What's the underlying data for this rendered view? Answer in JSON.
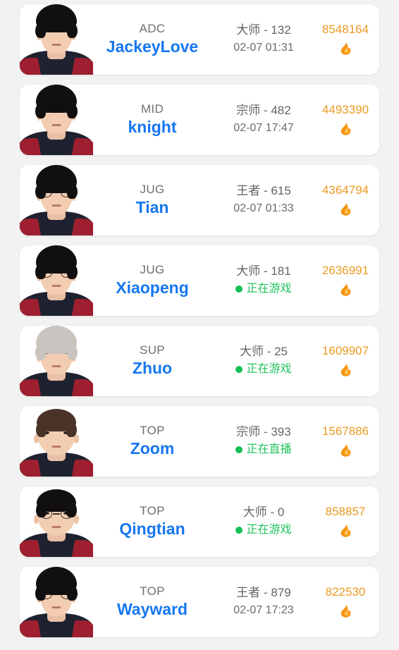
{
  "theme": {
    "page_background": "#f2f2f2",
    "card_background": "#ffffff",
    "nickname_color": "#1677f0",
    "position_color": "#6e6e6e",
    "rank_color": "#646464",
    "heat_color": "#eb9a22",
    "online_color": "#22c35e",
    "flame_color": "#f59412"
  },
  "icons": {
    "flame": "flame-icon",
    "status_dot": "online-status-dot"
  },
  "players": [
    {
      "position": "ADC",
      "nickname": "JackeyLove",
      "rank": "大师 - 132",
      "status_text": "02-07 01:31",
      "status_type": "timestamp",
      "heat": "8548164",
      "avatar": {
        "hair": "black",
        "hair_len": "long",
        "glasses": false,
        "face": "normal"
      }
    },
    {
      "position": "MID",
      "nickname": "knight",
      "rank": "宗师 - 482",
      "status_text": "02-07 17:47",
      "status_type": "timestamp",
      "heat": "4493390",
      "avatar": {
        "hair": "black",
        "hair_len": "long",
        "glasses": false,
        "face": "normal"
      }
    },
    {
      "position": "JUG",
      "nickname": "Tian",
      "rank": "王者 - 615",
      "status_text": "02-07 01:33",
      "status_type": "timestamp",
      "heat": "4364794",
      "avatar": {
        "hair": "black",
        "hair_len": "long",
        "glasses": true,
        "face": "normal"
      }
    },
    {
      "position": "JUG",
      "nickname": "Xiaopeng",
      "rank": "大师 - 181",
      "status_text": "正在游戏",
      "status_type": "online",
      "heat": "2636991",
      "avatar": {
        "hair": "black",
        "hair_len": "long",
        "glasses": true,
        "face": "normal"
      }
    },
    {
      "position": "SUP",
      "nickname": "Zhuo",
      "rank": "大师 - 25",
      "status_text": "正在游戏",
      "status_type": "online",
      "heat": "1609907",
      "avatar": {
        "hair": "silver",
        "hair_len": "long",
        "glasses": false,
        "face": "normal"
      }
    },
    {
      "position": "TOP",
      "nickname": "Zoom",
      "rank": "宗师 - 393",
      "status_text": "正在直播",
      "status_type": "online",
      "heat": "1567886",
      "avatar": {
        "hair": "brown",
        "hair_len": "short",
        "glasses": false,
        "face": "wide"
      }
    },
    {
      "position": "TOP",
      "nickname": "Qingtian",
      "rank": "大师 - 0",
      "status_text": "正在游戏",
      "status_type": "online",
      "heat": "858857",
      "avatar": {
        "hair": "black",
        "hair_len": "short",
        "glasses": true,
        "face": "wide"
      }
    },
    {
      "position": "TOP",
      "nickname": "Wayward",
      "rank": "王者 - 879",
      "status_text": "02-07 17:23",
      "status_type": "timestamp",
      "heat": "822530",
      "avatar": {
        "hair": "black",
        "hair_len": "long",
        "glasses": true,
        "face": "normal"
      }
    }
  ]
}
